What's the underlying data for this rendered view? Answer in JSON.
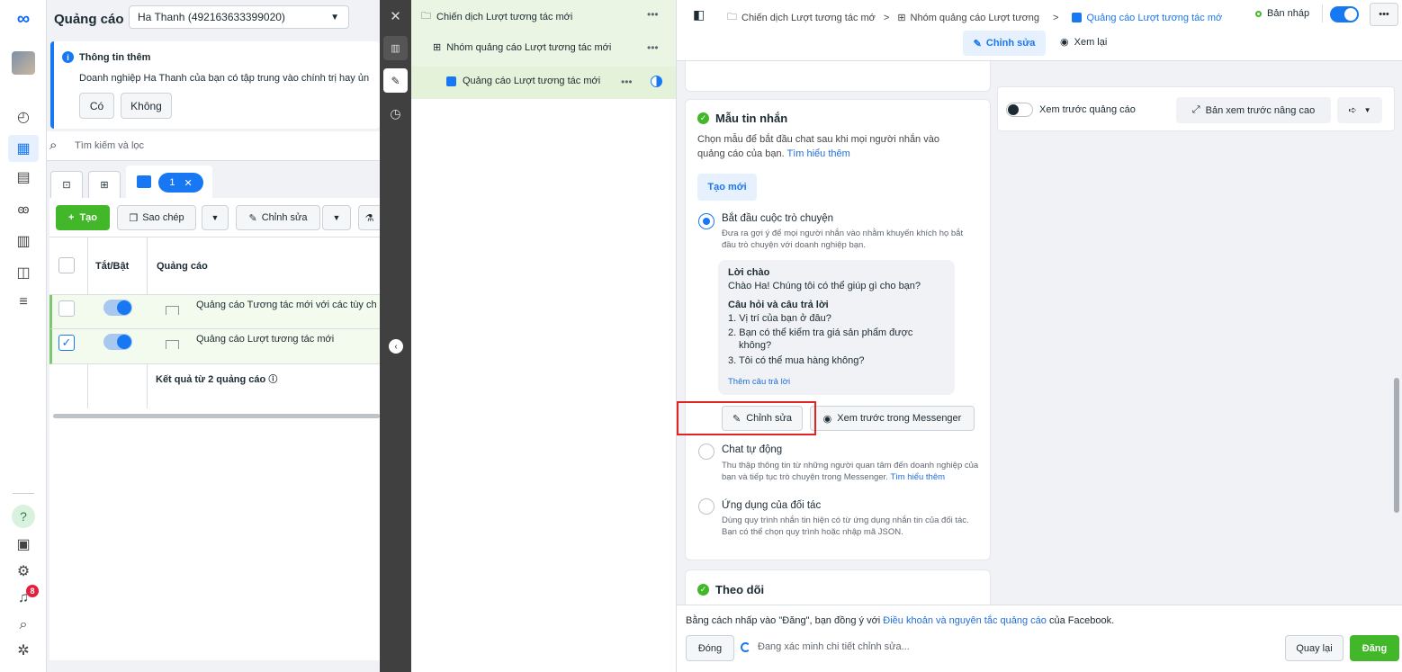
{
  "ads_manager": {
    "title": "Quảng cáo",
    "account": "Ha Thanh (492163633399020)",
    "notice_title": "Thông tin thêm",
    "notice_text": "Doanh nghiệp Ha Thanh của bạn có tập trung vào chính trị hay ủn",
    "notice_yes": "Có",
    "notice_no": "Không",
    "search_placeholder": "Tìm kiếm và lọc",
    "selected_count": "1",
    "toolbar": {
      "create": "Tạo",
      "duplicate": "Sao chép",
      "edit": "Chỉnh sửa"
    },
    "table": {
      "col_toggle": "Tắt/Bật",
      "col_ad": "Quảng cáo",
      "rows": [
        {
          "name": "Quảng cáo Tương tác mới với các tùy ch",
          "on": true,
          "checked": false
        },
        {
          "name": "Quảng cáo Lượt tương tác mới",
          "on": true,
          "checked": true
        }
      ],
      "result": "Kết quả từ 2 quảng cáo"
    },
    "notification_count": "8"
  },
  "tree": {
    "campaign": "Chiến dịch Lượt tương tác mới",
    "adset": "Nhóm quảng cáo Lượt tương tác mới",
    "ad": "Quảng cáo Lượt tương tác mới",
    "more": "•••"
  },
  "editor": {
    "breadcrumb": {
      "campaign": "Chiến dịch Lượt tương tác mớ",
      "adset": "Nhóm quảng cáo Lượt tương",
      "ad": "Quảng cáo Lượt tương tác mớ",
      "sep": ">"
    },
    "status": "Bản nháp",
    "tab_edit": "Chỉnh sửa",
    "tab_review": "Xem lại",
    "message_template": {
      "title": "Mẫu tin nhắn",
      "description": "Chọn mẫu để bắt đầu chat sau khi mọi người nhắn vào quảng cáo của bạn.",
      "learn_more": "Tìm hiểu thêm",
      "create_new": "Tạo mới",
      "options": [
        {
          "label": "Bắt đầu cuộc trò chuyện",
          "desc": "Đưa ra gợi ý để mọi người nhắn vào nhằm khuyến khích họ bắt đầu trò chuyện với doanh nghiệp bạn.",
          "selected": true
        },
        {
          "label": "Chat tự động",
          "desc": "Thu thập thông tin từ những người quan tâm đến doanh nghiệp của bạn và tiếp tục trò chuyện trong Messenger.",
          "link": "Tìm hiểu thêm",
          "selected": false
        },
        {
          "label": "Ứng dụng của đối tác",
          "desc": "Dùng quy trình nhắn tin hiện có từ ứng dụng nhắn tin của đối tác. Bạn có thể chọn quy trình hoặc nhập mã JSON.",
          "selected": false
        }
      ],
      "greeting_label": "Lời chào",
      "greeting_text": "Chào Ha! Chúng tôi có thể giúp gì cho bạn?",
      "qa_label": "Câu hỏi và câu trả lời",
      "questions": [
        "1. Vị trí của bạn ở đâu?",
        "2. Bạn có thể kiểm tra giá sản phẩm được",
        "không?",
        "3. Tôi có thể mua hàng không?"
      ],
      "add_answer": "Thêm câu trả lời",
      "edit_button": "Chỉnh sửa",
      "preview_messenger": "Xem trước trong Messenger"
    },
    "tracking_title": "Theo dõi",
    "preview": {
      "toggle_label": "Xem trước quảng cáo",
      "advanced": "Bản xem trước nâng cao"
    },
    "footer": {
      "terms_prefix": "Bằng cách nhấp vào \"Đăng\", bạn đồng ý với ",
      "terms_link": "Điều khoản và nguyên tắc quảng cáo",
      "terms_suffix": " của Facebook.",
      "close": "Đóng",
      "verifying": "Đang xác minh chi tiết chỉnh sửa...",
      "back": "Quay lại",
      "publish": "Đăng"
    },
    "accent": "#1877f2",
    "publish_color": "#42b72a"
  }
}
